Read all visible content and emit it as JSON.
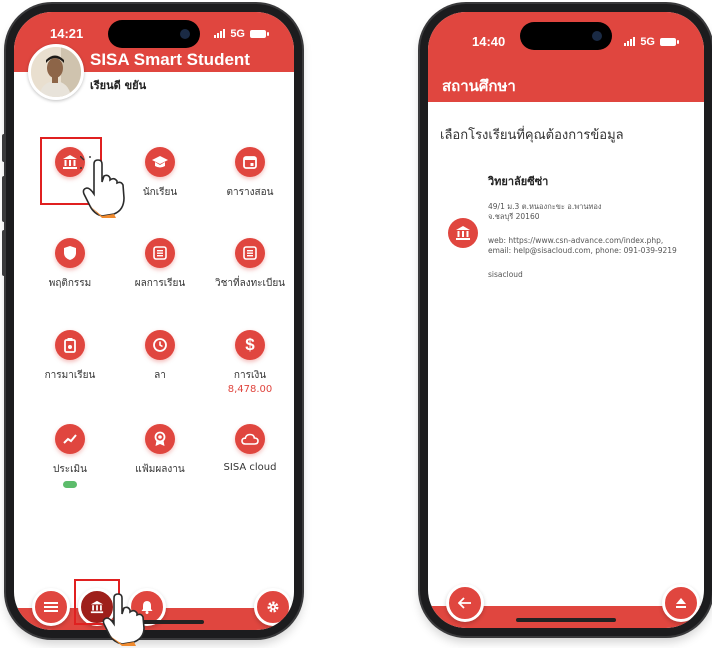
{
  "colors": {
    "accent": "#e0463f",
    "success": "#5cbc6b",
    "highlight": "#e02020"
  },
  "phone1": {
    "status": {
      "time": "14:21",
      "network": "5G"
    },
    "app_title": "SISA Smart Student",
    "user_name": "เรียนดี ขยัน",
    "menu": [
      {
        "icon": "school-building-icon",
        "label": ""
      },
      {
        "icon": "graduation-cap-icon",
        "label": "นักเรียน"
      },
      {
        "icon": "calendar-icon",
        "label": "ตารางสอน"
      },
      {
        "icon": "shield-icon",
        "label": "พฤติกรรม"
      },
      {
        "icon": "list-icon",
        "label": "ผลการเรียน"
      },
      {
        "icon": "list-icon",
        "label": "วิชาที่ลงทะเบียน"
      },
      {
        "icon": "attendance-icon",
        "label": "การมาเรียน"
      },
      {
        "icon": "clock-icon",
        "label": "ลา"
      },
      {
        "icon": "dollar-icon",
        "label": "การเงิน",
        "sub": "8,478.00"
      },
      {
        "icon": "trend-icon",
        "label": "ประเมิน"
      },
      {
        "icon": "award-icon",
        "label": "แฟ้มผลงาน"
      },
      {
        "icon": "cloud-icon",
        "label": "SISA cloud"
      }
    ],
    "bottom_nav": [
      "menu-icon",
      "school-building-icon",
      "bell-icon",
      "gear-icon"
    ]
  },
  "phone2": {
    "status": {
      "time": "14:40",
      "network": "5G"
    },
    "page_title": "สถานศึกษา",
    "prompt": "เลือกโรงเรียนที่คุณต้องการข้อมูล",
    "school": {
      "name": "วิทยาลัยซีซ่า",
      "address_line1": "49/1 ม.3 ต.หนองกะขะ อ.พานทอง",
      "address_line2": "จ.ชลบุรี 20160",
      "contact_line1": "web: https://www.csn-advance.com/index.php,",
      "contact_line2": "email: help@sisacloud.com, phone: 091-039-9219",
      "code": "sisacloud"
    },
    "bottom_nav": [
      "back-arrow-icon",
      "eject-icon"
    ]
  }
}
